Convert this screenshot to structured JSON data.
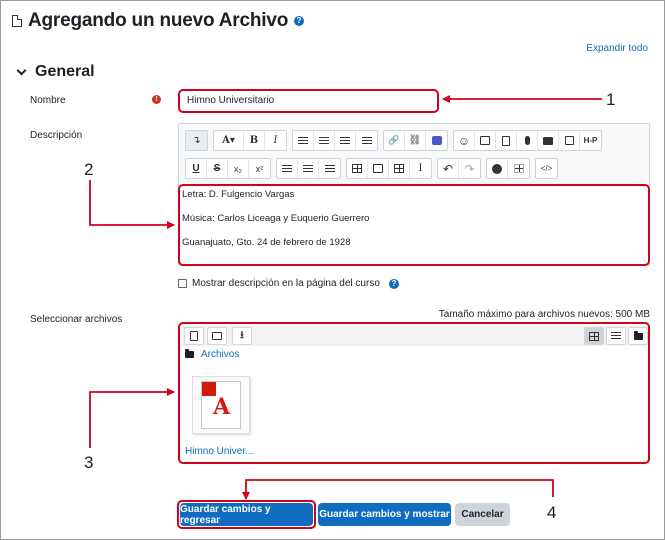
{
  "page": {
    "title": "Agregando un nuevo Archivo",
    "help_glyph": "?",
    "expand_all": "Expandir todo"
  },
  "section": {
    "title": "General"
  },
  "form": {
    "name_label": "Nombre",
    "required_glyph": "!",
    "name_value": "Himno Universitario",
    "description_label": "Descripción",
    "description_lines": [
      "Letra: D. Fulgencio Vargas",
      "Música: Carlos Liceaga y Euquerio Guerrero",
      "Guanajuato, Gto. 24 de febrero de 1928"
    ],
    "show_description_label": "Mostrar descripción en la página del curso",
    "show_description_checked": false,
    "select_files_label": "Seleccionar archivos",
    "max_size_text": "Tamaño máximo para archivos nuevos: 500 MB"
  },
  "toolbar": {
    "font_a": "A",
    "bold": "B",
    "italic": "I",
    "underline": "U",
    "strike": "S",
    "subscript": "x₂",
    "superscript": "x²",
    "h5p": "H-P",
    "undo": "↶",
    "redo": "↷",
    "code": "</>",
    "link": "🔗",
    "emoji": "☺",
    "mic": "🎤",
    "accessibility": "♿",
    "cursor_i": "I"
  },
  "filepicker": {
    "path_label": "Archivos",
    "file_name": "Himno Univer..."
  },
  "buttons": {
    "save_return": "Guardar cambios y regresar",
    "save_show": "Guardar cambios y mostrar",
    "cancel": "Cancelar"
  },
  "annotations": {
    "m1": "1",
    "m2": "2",
    "m3": "3",
    "m4": "4",
    "color": "#d0021b"
  },
  "colors": {
    "primary": "#0f6cbf",
    "annotation_red": "#d0021b",
    "required_red": "#ca3120",
    "secondary": "#ced4da"
  }
}
